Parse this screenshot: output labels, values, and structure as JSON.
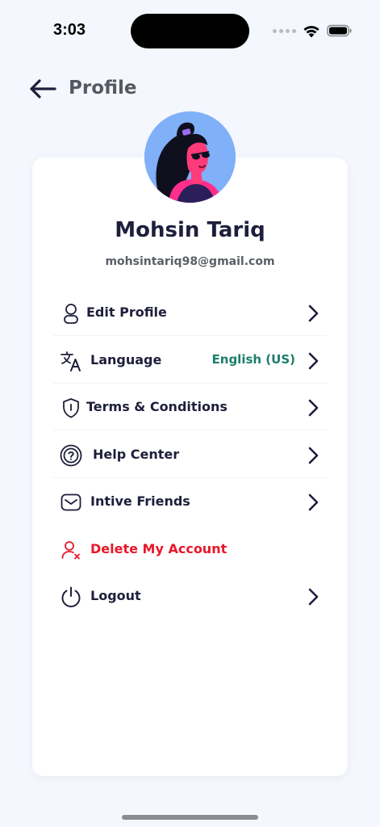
{
  "status_bar": {
    "time": "3:03",
    "icons": [
      "signal-dots-icon",
      "wifi-icon",
      "battery-icon"
    ]
  },
  "header": {
    "title": "Profile",
    "back_icon": "arrow-left-icon"
  },
  "profile": {
    "name": "Mohsin Tariq",
    "email": "mohsintariq98@gmail.com",
    "avatar_icon": "avatar-illustration"
  },
  "menu": {
    "items": [
      {
        "label": "Edit Profile",
        "icon": "user-icon",
        "value": ""
      },
      {
        "label": "Language",
        "icon": "translate-icon",
        "value": "English (US)"
      },
      {
        "label": "Terms & Conditions",
        "icon": "shield-icon",
        "value": ""
      },
      {
        "label": "Help Center",
        "icon": "help-icon",
        "value": ""
      },
      {
        "label": "Intive Friends",
        "icon": "mail-icon",
        "value": ""
      },
      {
        "label": "Delete My Account",
        "icon": "user-remove-icon",
        "value": ""
      },
      {
        "label": "Logout",
        "icon": "power-icon",
        "value": ""
      }
    ]
  },
  "colors": {
    "background": "#f4f7fd",
    "text_primary": "#1e1f3b",
    "accent_green": "#1e7d6c",
    "danger_red": "#e8172a",
    "avatar_bg": "#7fb0f8"
  }
}
